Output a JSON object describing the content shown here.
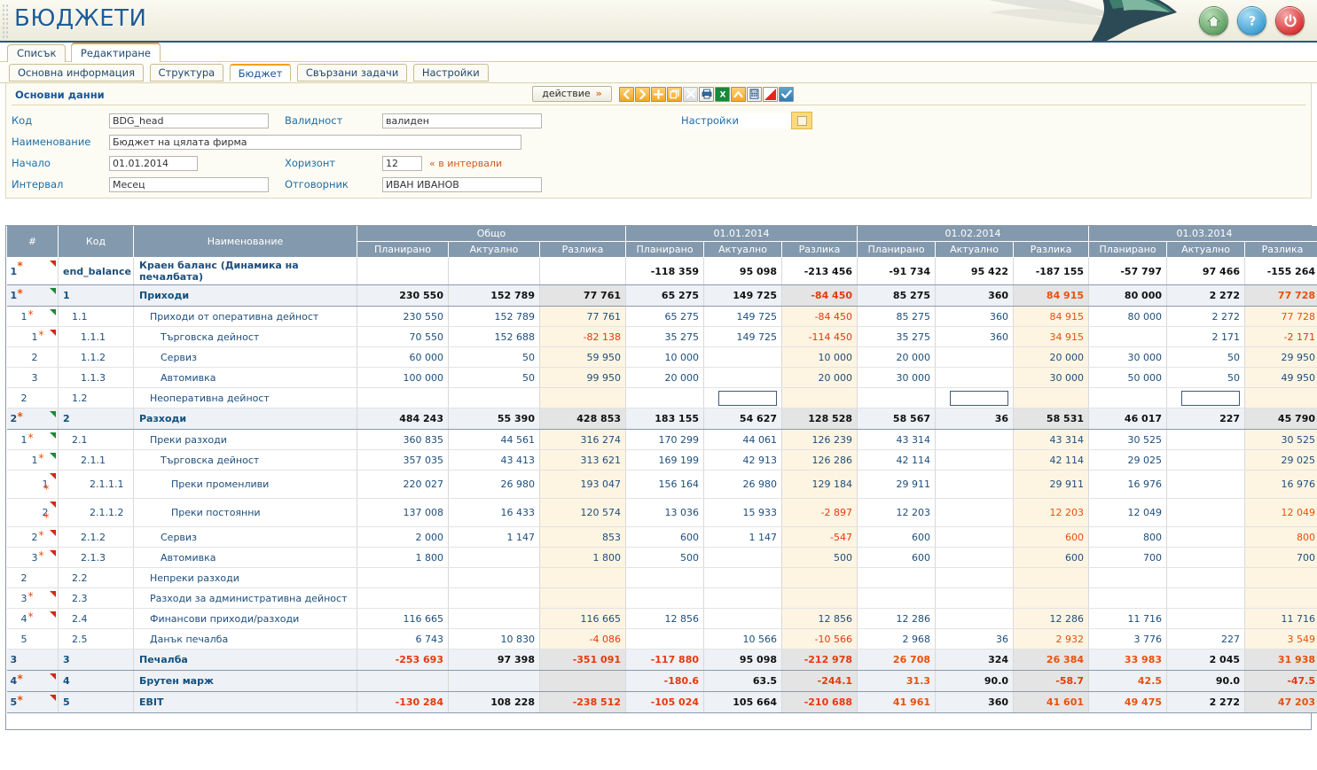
{
  "app": {
    "title": "БЮДЖЕТИ",
    "header_icons": [
      {
        "name": "home-icon",
        "label": "Начало"
      },
      {
        "name": "help-icon",
        "label": "Помощ"
      },
      {
        "name": "power-icon",
        "label": "Изход"
      }
    ]
  },
  "tabs": [
    {
      "label": "Списък",
      "active": false
    },
    {
      "label": "Редактиране",
      "active": true
    }
  ],
  "subtabs": [
    {
      "label": "Основна информация",
      "active": false
    },
    {
      "label": "Структура",
      "active": false
    },
    {
      "label": "Бюджет",
      "active": true
    },
    {
      "label": "Свързани задачи",
      "active": false
    },
    {
      "label": "Настройки",
      "active": false
    }
  ],
  "panel": {
    "title": "Основни данни",
    "fields": {
      "code_label": "Код",
      "code_value": "BDG_head",
      "validity_label": "Валидност",
      "validity_value": "валиден",
      "name_label": "Наименование",
      "name_value": "Бюджет на цялата фирма",
      "start_label": "Начало",
      "start_value": "01.01.2014",
      "horizon_label": "Хоризонт",
      "horizon_value": "12",
      "horizon_hint": "« в интервали",
      "interval_label": "Интервал",
      "interval_value": "Месец",
      "responsible_label": "Отговорник",
      "responsible_value": "ИВАН ИВАНОВ"
    },
    "settings_label": "Настройки"
  },
  "toolbar": {
    "action_label": "действие",
    "action_chevron": "»",
    "icons": [
      {
        "name": "prev-arrow-icon"
      },
      {
        "name": "next-arrow-icon"
      },
      {
        "name": "add-plus-icon"
      },
      {
        "name": "copy-icon"
      },
      {
        "name": "delete-x-icon"
      },
      {
        "name": "print-icon"
      },
      {
        "name": "excel-export-icon"
      },
      {
        "name": "up-arrow-icon"
      },
      {
        "name": "calculator-icon"
      },
      {
        "name": "chart-red-icon"
      },
      {
        "name": "confirm-check-icon"
      }
    ]
  },
  "grid": {
    "columns": {
      "index": "#",
      "code": "Код",
      "name": "Наименование"
    },
    "groups": [
      {
        "label": "Общо",
        "sub": [
          "Планирано",
          "Актуално",
          "Разлика"
        ]
      },
      {
        "label": "01.01.2014",
        "sub": [
          "Планирано",
          "Актуално",
          "Разлика"
        ]
      },
      {
        "label": "01.02.2014",
        "sub": [
          "Планирано",
          "Актуално",
          "Разлика"
        ]
      },
      {
        "label": "01.03.2014",
        "sub": [
          "Планирано",
          "Актуално",
          "Разлика"
        ]
      }
    ],
    "rows": [
      {
        "idx": "1",
        "star": true,
        "tri": "red",
        "level": "top",
        "indent": 0,
        "code": "end_balance",
        "name": "Краен баланс (Динамика на печалбата)",
        "cells": [
          "",
          "",
          "",
          "-118 359",
          "95 098",
          "-213 456",
          "-91 734",
          "95 422",
          "-187 155",
          "-57 797",
          "97 466",
          "-155 264"
        ],
        "neg": [
          false,
          false,
          false,
          true,
          false,
          true,
          true,
          false,
          true,
          true,
          false,
          true
        ]
      },
      {
        "idx": "1",
        "star": true,
        "tri": "green",
        "level": "lvl0",
        "indent": 0,
        "code": "1",
        "name": "Приходи",
        "cells": [
          "230 550",
          "152 789",
          "77 761",
          "65 275",
          "149 725",
          "-84 450",
          "85 275",
          "360",
          "84 915",
          "80 000",
          "2 272",
          "77 728"
        ],
        "neg": [
          false,
          false,
          false,
          false,
          false,
          true,
          false,
          false,
          true,
          false,
          false,
          true
        ]
      },
      {
        "idx": "1",
        "star": true,
        "tri": "green",
        "level": "data",
        "indent": 1,
        "code": "1.1",
        "name": "Приходи от оперативна дейност",
        "cells": [
          "230 550",
          "152 789",
          "77 761",
          "65 275",
          "149 725",
          "-84 450",
          "85 275",
          "360",
          "84 915",
          "80 000",
          "2 272",
          "77 728"
        ],
        "neg": [
          false,
          false,
          false,
          false,
          false,
          true,
          false,
          false,
          true,
          false,
          false,
          true
        ]
      },
      {
        "idx": "1",
        "star": true,
        "tri": "red",
        "level": "data",
        "indent": 2,
        "code": "1.1.1",
        "name": "Търговска дейност",
        "cells": [
          "70 550",
          "152 688",
          "-82 138",
          "35 275",
          "149 725",
          "-114 450",
          "35 275",
          "360",
          "34 915",
          "",
          "2 171",
          "-2 171"
        ],
        "neg": [
          false,
          false,
          true,
          false,
          false,
          true,
          false,
          false,
          true,
          false,
          false,
          true
        ]
      },
      {
        "idx": "2",
        "star": false,
        "tri": "",
        "level": "data",
        "indent": 2,
        "code": "1.1.2",
        "name": "Сервиз",
        "cells": [
          "60 000",
          "50",
          "59 950",
          "10 000",
          "",
          "10 000",
          "20 000",
          "",
          "20 000",
          "30 000",
          "50",
          "29 950"
        ],
        "neg": [
          false,
          false,
          false,
          false,
          false,
          false,
          false,
          false,
          false,
          false,
          false,
          false
        ]
      },
      {
        "idx": "3",
        "star": false,
        "tri": "",
        "level": "data",
        "indent": 2,
        "code": "1.1.3",
        "name": "Автомивка",
        "cells": [
          "100 000",
          "50",
          "99 950",
          "20 000",
          "",
          "20 000",
          "30 000",
          "",
          "30 000",
          "50 000",
          "50",
          "49 950"
        ],
        "neg": [
          false,
          false,
          false,
          false,
          false,
          false,
          false,
          false,
          false,
          false,
          false,
          false
        ]
      },
      {
        "idx": "2",
        "star": false,
        "tri": "",
        "level": "data",
        "indent": 1,
        "code": "1.2",
        "name": "Неоперативна дейност",
        "cells": [
          "",
          "",
          "",
          "",
          "__INPUT__",
          "",
          "",
          "__INPUT__",
          "",
          "",
          "__INPUT__",
          ""
        ],
        "neg": [
          false,
          false,
          false,
          false,
          false,
          false,
          false,
          false,
          false,
          false,
          false,
          false
        ]
      },
      {
        "idx": "2",
        "star": true,
        "tri": "green",
        "level": "lvl0",
        "indent": 0,
        "code": "2",
        "name": "Разходи",
        "cells": [
          "484 243",
          "55 390",
          "428 853",
          "183 155",
          "54 627",
          "128 528",
          "58 567",
          "36",
          "58 531",
          "46 017",
          "227",
          "45 790"
        ],
        "neg": [
          false,
          false,
          false,
          false,
          false,
          false,
          false,
          false,
          false,
          false,
          false,
          false
        ]
      },
      {
        "idx": "1",
        "star": true,
        "tri": "green",
        "level": "data",
        "indent": 1,
        "code": "2.1",
        "name": "Преки разходи",
        "cells": [
          "360 835",
          "44 561",
          "316 274",
          "170 299",
          "44 061",
          "126 239",
          "43 314",
          "",
          "43 314",
          "30 525",
          "",
          "30 525"
        ],
        "neg": [
          false,
          false,
          false,
          false,
          false,
          false,
          false,
          false,
          false,
          false,
          false,
          false
        ]
      },
      {
        "idx": "1",
        "star": true,
        "tri": "green",
        "level": "data",
        "indent": 2,
        "code": "2.1.1",
        "name": "Търговска дейност",
        "cells": [
          "357 035",
          "43 413",
          "313 621",
          "169 199",
          "42 913",
          "126 286",
          "42 114",
          "",
          "42 114",
          "29 025",
          "",
          "29 025"
        ],
        "neg": [
          false,
          false,
          false,
          false,
          false,
          false,
          false,
          false,
          false,
          false,
          false,
          false
        ]
      },
      {
        "idx": "1",
        "star": true,
        "tri": "red",
        "level": "data",
        "indent": 3,
        "tall": true,
        "code": "2.1.1.1",
        "name": "Преки променливи",
        "cells": [
          "220 027",
          "26 980",
          "193 047",
          "156 164",
          "26 980",
          "129 184",
          "29 911",
          "",
          "29 911",
          "16 976",
          "",
          "16 976"
        ],
        "neg": [
          false,
          false,
          false,
          false,
          false,
          false,
          false,
          false,
          false,
          false,
          false,
          false
        ]
      },
      {
        "idx": "2",
        "star": true,
        "tri": "red",
        "level": "data",
        "indent": 3,
        "tall": true,
        "code": "2.1.1.2",
        "name": "Преки постоянни",
        "cells": [
          "137 008",
          "16 433",
          "120 574",
          "13 036",
          "15 933",
          "-2 897",
          "12 203",
          "",
          "12 203",
          "12 049",
          "",
          "12 049"
        ],
        "neg": [
          false,
          false,
          false,
          false,
          false,
          true,
          false,
          false,
          true,
          false,
          false,
          true
        ]
      },
      {
        "idx": "2",
        "star": true,
        "tri": "red",
        "level": "data",
        "indent": 2,
        "code": "2.1.2",
        "name": "Сервиз",
        "cells": [
          "2 000",
          "1 147",
          "853",
          "600",
          "1 147",
          "-547",
          "600",
          "",
          "600",
          "800",
          "",
          "800"
        ],
        "neg": [
          false,
          false,
          false,
          false,
          false,
          true,
          false,
          false,
          true,
          false,
          false,
          true
        ]
      },
      {
        "idx": "3",
        "star": true,
        "tri": "red",
        "level": "data",
        "indent": 2,
        "code": "2.1.3",
        "name": "Автомивка",
        "cells": [
          "1 800",
          "",
          "1 800",
          "500",
          "",
          "500",
          "600",
          "",
          "600",
          "700",
          "",
          "700"
        ],
        "neg": [
          false,
          false,
          false,
          false,
          false,
          false,
          false,
          false,
          false,
          false,
          false,
          false
        ]
      },
      {
        "idx": "2",
        "star": false,
        "tri": "",
        "level": "data",
        "indent": 1,
        "code": "2.2",
        "name": "Непреки разходи",
        "cells": [
          "",
          "",
          "",
          "",
          "",
          "",
          "",
          "",
          "",
          "",
          "",
          ""
        ],
        "neg": [
          false,
          false,
          false,
          false,
          false,
          false,
          false,
          false,
          false,
          false,
          false,
          false
        ]
      },
      {
        "idx": "3",
        "star": true,
        "tri": "red",
        "level": "data",
        "indent": 1,
        "code": "2.3",
        "name": "Разходи за административна дейност",
        "cells": [
          "",
          "",
          "",
          "",
          "",
          "",
          "",
          "",
          "",
          "",
          "",
          ""
        ],
        "neg": [
          false,
          false,
          false,
          false,
          false,
          false,
          false,
          false,
          false,
          false,
          false,
          false
        ]
      },
      {
        "idx": "4",
        "star": true,
        "tri": "red",
        "level": "data",
        "indent": 1,
        "code": "2.4",
        "name": "Финансови приходи/разходи",
        "cells": [
          "116 665",
          "",
          "116 665",
          "12 856",
          "",
          "12 856",
          "12 286",
          "",
          "12 286",
          "11 716",
          "",
          "11 716"
        ],
        "neg": [
          false,
          false,
          false,
          false,
          false,
          false,
          false,
          false,
          false,
          false,
          false,
          false
        ]
      },
      {
        "idx": "5",
        "star": false,
        "tri": "",
        "level": "data",
        "indent": 1,
        "code": "2.5",
        "name": "Данък печалба",
        "cells": [
          "6 743",
          "10 830",
          "-4 086",
          "",
          "10 566",
          "-10 566",
          "2 968",
          "36",
          "2 932",
          "3 776",
          "227",
          "3 549"
        ],
        "neg": [
          false,
          false,
          true,
          false,
          false,
          true,
          false,
          false,
          true,
          false,
          false,
          true
        ]
      },
      {
        "idx": "3",
        "star": false,
        "tri": "",
        "level": "lvl0",
        "indent": 0,
        "code": "3",
        "name": "Печалба",
        "cells": [
          "-253 693",
          "97 398",
          "-351 091",
          "-117 880",
          "95 098",
          "-212 978",
          "26 708",
          "324",
          "26 384",
          "33 983",
          "2 045",
          "31 938"
        ],
        "neg": [
          true,
          false,
          true,
          true,
          false,
          true,
          true,
          false,
          true,
          true,
          false,
          true
        ]
      },
      {
        "idx": "4",
        "star": true,
        "tri": "red",
        "level": "lvl0",
        "indent": 0,
        "code": "4",
        "name": "Брутен марж",
        "cells": [
          "",
          "",
          "",
          "-180.6",
          "63.5",
          "-244.1",
          "31.3",
          "90.0",
          "-58.7",
          "42.5",
          "90.0",
          "-47.5"
        ],
        "neg": [
          false,
          false,
          false,
          true,
          false,
          true,
          true,
          false,
          true,
          true,
          false,
          true
        ]
      },
      {
        "idx": "5",
        "star": true,
        "tri": "red",
        "level": "lvl0",
        "indent": 0,
        "code": "5",
        "name": "EBIT",
        "cells": [
          "-130 284",
          "108 228",
          "-238 512",
          "-105 024",
          "105 664",
          "-210 688",
          "41 961",
          "360",
          "41 601",
          "49 475",
          "2 272",
          "47 203"
        ],
        "neg": [
          true,
          false,
          true,
          true,
          false,
          true,
          true,
          false,
          true,
          true,
          false,
          true
        ]
      }
    ]
  },
  "colors": {
    "accent_blue": "#1f5c96",
    "header_gray_blue": "#8399ad",
    "negative_red": "#e8380d",
    "diff_bg": "#fdf4e2",
    "tab_orange": "#f0a01e"
  }
}
